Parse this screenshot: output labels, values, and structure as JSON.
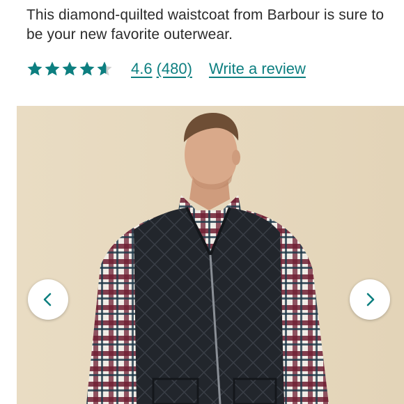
{
  "product": {
    "description": "This diamond-quilted waistcoat from Barbour is sure to be your new favorite outerwear."
  },
  "rating": {
    "value": "4.6",
    "value_numeric": 4.6,
    "max": 5,
    "count": "(480)",
    "write_review_label": "Write a review",
    "star_color": "#0d7f80",
    "empty_star_color": "#d0d0d0"
  },
  "carousel": {
    "prev_icon": "chevron-left-icon",
    "next_icon": "chevron-right-icon",
    "accent_color": "#0d7f80"
  },
  "colors": {
    "text": "#2b2b2b",
    "link": "#0d7f80",
    "photo_background": "#e7d9bf",
    "vest": "#1f2329"
  }
}
